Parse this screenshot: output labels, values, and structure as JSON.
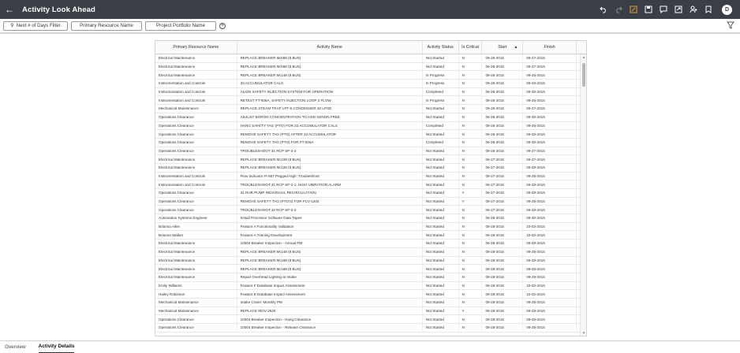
{
  "header": {
    "title": "Activity Look Ahead",
    "avatar_initial": "D",
    "icons": [
      "back-arrow-icon",
      "undo-icon",
      "redo-icon",
      "edit-icon",
      "save-icon",
      "comment-icon",
      "share-icon",
      "user-add-icon",
      "bookmark-icon"
    ]
  },
  "filters": {
    "days": "Next # of Days Filter",
    "resource": "Primary Resource Name",
    "portfolio": "Project Portfolio Name",
    "add": "+"
  },
  "table": {
    "columns": [
      "Primary Resource Name",
      "Activity Name",
      "Activity Status",
      "Is Critical",
      "Start",
      "Finish"
    ],
    "sort_column": "Start",
    "sort_direction": "ascending",
    "rows": [
      [
        "Electrical Maintenance",
        "REPLACE BREAKER 5K068 (8 BUS)",
        "Not Started",
        "N",
        "09-26-2015",
        "09-27-2015"
      ],
      [
        "Electrical Maintenance",
        "REPLACE BREAKER 5K068 (8 BUS)",
        "Not Started",
        "N",
        "09-26-2015",
        "09-27-2015"
      ],
      [
        "Electrical Maintenance",
        "REPLACE BREAKER 5K148 (8 BUS)",
        "In Progress",
        "N",
        "09-26-2015",
        "09-26-2015"
      ],
      [
        "Instrumentation and Controls",
        "33 ACCUMULATOR CALS",
        "In Progress",
        "N",
        "09-26-2015",
        "09-26-2015"
      ],
      [
        "Instrumentation and Controls",
        "ALIGN SAFETY INJECTION SYSTEM FOR OPERATION",
        "Completed",
        "N",
        "09-26-2015",
        "09-26-2015"
      ],
      [
        "Instrumentation and Controls",
        "RETEST FT-926A, SAFETY INJECTION LOOP 3 FLOW",
        "In Progress",
        "N",
        "09-26-2015",
        "09-26-2015"
      ],
      [
        "Mechanical Maintenance",
        "REPLACE STEAM TRAP LPT-8 CONDENSER 32 LPSD",
        "Not Started",
        "N",
        "09-26-2015",
        "09-27-2015"
      ],
      [
        "Operations Clearance",
        "ADJUST BORON CONCENTRATION TO HSD XENON FREE",
        "Not Started",
        "N",
        "09-26-2015",
        "09-26-2015"
      ],
      [
        "Operations Clearance",
        "HANG SAFETY TAG (PTO) FOR 33 ACCUMULATOR CALS",
        "Completed",
        "N",
        "09-26-2015",
        "09-26-2015"
      ],
      [
        "Operations Clearance",
        "REMOVE SAFETY TAG (PTO) AFTER 33 ACCUMULATOR",
        "Not Started",
        "N",
        "09-26-2015",
        "09-26-2015"
      ],
      [
        "Operations Clearance",
        "REMOVE SAFETY TAG (PTO) FOR FT-926A",
        "Completed",
        "N",
        "09-26-2015",
        "09-26-2015"
      ],
      [
        "Operations Clearance",
        "TROUBLESHOOT 31 RCP SP-2-2",
        "Not Started",
        "N",
        "09-26-2015",
        "09-27-2015"
      ],
      [
        "Electrical Maintenance",
        "REPLACE BREAKER 5K108 (8 BUS)",
        "Not Started",
        "N",
        "09-27-2015",
        "09-27-2015"
      ],
      [
        "Electrical Maintenance",
        "REPLACE BREAKER 5K128 (8 BUS)",
        "Not Started",
        "N",
        "09-27-2015",
        "09-28-2015"
      ],
      [
        "Instrumentation and Controls",
        "Flow Indicator FI-567 Pegged High: Troubleshoot",
        "Not Started",
        "N",
        "09-27-2015",
        "09-28-2015"
      ],
      [
        "Instrumentation and Controls",
        "TROUBLESHOOT 31 RCP SP-2-1, HIGH VIBRATION ALARM",
        "Not Started",
        "N",
        "09-27-2015",
        "09-28-2015"
      ],
      [
        "Operations Clearance",
        "31 RHR PUMP INDIVIDUAL RECIRCULATION",
        "Not Started",
        "Y",
        "09-27-2015",
        "09-28-2015"
      ],
      [
        "Operations Clearance",
        "REMOVE SAFETY TAG (PTO'S) FOR FCV-1204",
        "Not Started",
        "Y",
        "09-27-2015",
        "09-28-2015"
      ],
      [
        "Operations Clearance",
        "TROUBLESHOOT 32 RCP SP-2-3",
        "Not Started",
        "N",
        "09-27-2015",
        "09-28-2015"
      ],
      [
        "Automation Systems Engineer",
        "Install Processor Software Data Tapes",
        "Not Started",
        "N",
        "09-28-2015",
        "09-30-2015"
      ],
      [
        "Brianna Allen",
        "Feature A Functionality Validation",
        "Not Started",
        "N",
        "09-28-2015",
        "10-02-2015"
      ],
      [
        "Brianna Walker",
        "Feature A Training Development",
        "Not Started",
        "N",
        "09-28-2015",
        "10-02-2015"
      ],
      [
        "Electrical Maintenance",
        "10004 Breaker Inspection - Annual PM",
        "Not Started",
        "N",
        "09-28-2015",
        "09-28-2015"
      ],
      [
        "Electrical Maintenance",
        "REPLACE BREAKER 5K148 (8 BUS)",
        "Not Started",
        "N",
        "09-28-2015",
        "09-28-2015"
      ],
      [
        "Electrical Maintenance",
        "REPLACE BREAKER 5K168 (8 BUS)",
        "Not Started",
        "N",
        "09-28-2015",
        "09-28-2015"
      ],
      [
        "Electrical Maintenance",
        "REPLACE BREAKER 5K188 (8 BUS)",
        "Not Started",
        "N",
        "09-28-2015",
        "09-28-2015"
      ],
      [
        "Electrical Maintenance",
        "Repair Overhead Lighting at Intake",
        "Not Started",
        "N",
        "09-28-2015",
        "09-29-2015"
      ],
      [
        "Emily Williams",
        "Feature F Database Impact Assessment",
        "Not Started",
        "N",
        "09-28-2015",
        "10-02-2015"
      ],
      [
        "Hailey Robinson",
        "Feature E Database Impact Assessment",
        "Not Started",
        "N",
        "09-28-2015",
        "10-02-2015"
      ],
      [
        "Mechanical Maintenance",
        "Intake Crane: Monthly PM",
        "Not Started",
        "N",
        "09-28-2015",
        "09-28-2015"
      ],
      [
        "Mechanical Maintenance",
        "REPLACE MOV-2530",
        "Not Started",
        "Y",
        "09-28-2015",
        "09-29-2015"
      ],
      [
        "Operations Clearance",
        "10004 Breaker Inspection - Hang Clearance",
        "Not Started",
        "N",
        "09-28-2015",
        "09-28-2015"
      ],
      [
        "Operations Clearance",
        "10004 Breaker Inspection - Release Clearance",
        "Not Started",
        "N",
        "09-28-2015",
        "09-28-2015"
      ]
    ]
  },
  "tabs": [
    {
      "label": "Overview",
      "active": false
    },
    {
      "label": "Activity Details",
      "active": true
    }
  ]
}
